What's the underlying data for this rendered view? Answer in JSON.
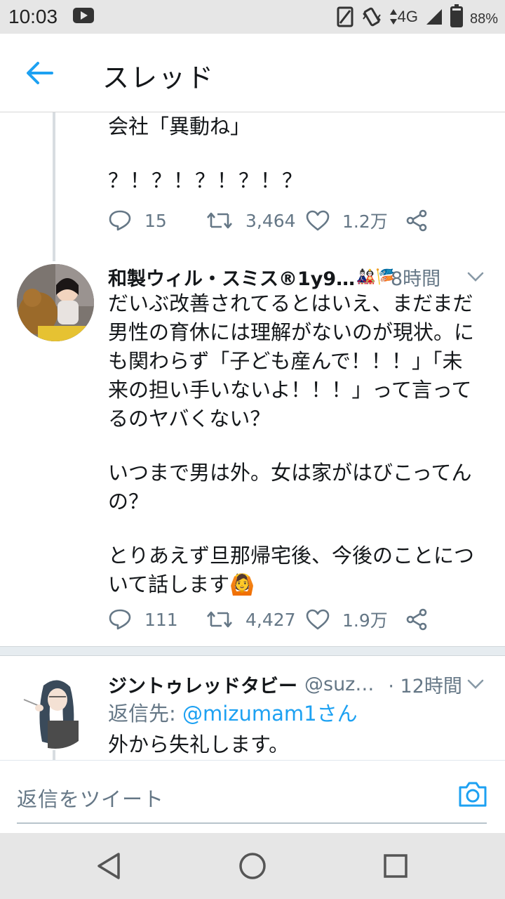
{
  "status_bar": {
    "time": "10:03",
    "network": "4G",
    "battery": "88%"
  },
  "header": {
    "title": "スレッド"
  },
  "tweets": [
    {
      "text_lines": [
        "会社「異動ね」",
        "",
        "？！？！？！？！？"
      ],
      "replies": "15",
      "retweets": "3,464",
      "likes": "1.2万"
    },
    {
      "name": "和製ウィル・スミス®1y9…",
      "emoji": "🎎🎏",
      "time": "8時間",
      "text_lines": [
        "だいぶ改善されてるとはいえ、まだまだ",
        "男性の育休には理解がないのが現状。に",
        "も関わらず「子ども産んで！！！」「未",
        "来の担い手いないよ！！！」って言って",
        "るのヤバくない？",
        "",
        "いつまで男は外。女は家がはびこってん",
        "の？",
        "",
        "とりあえず旦那帰宅後、今後のことにつ",
        "いて話します🙆"
      ],
      "replies": "111",
      "retweets": "4,427",
      "likes": "1.9万"
    },
    {
      "name": "ジントゥレッドタビー",
      "handle": "@suz…",
      "time": "· 12時間",
      "reply_to_prefix": "返信先: ",
      "reply_to_user": "@mizumam1さん",
      "text_lines": [
        "外から失礼します。"
      ]
    }
  ],
  "composer": {
    "placeholder": "返信をツイート"
  },
  "colors": {
    "accent": "#1da1f2",
    "secondary_text": "#657786",
    "primary_text": "#14171a"
  }
}
